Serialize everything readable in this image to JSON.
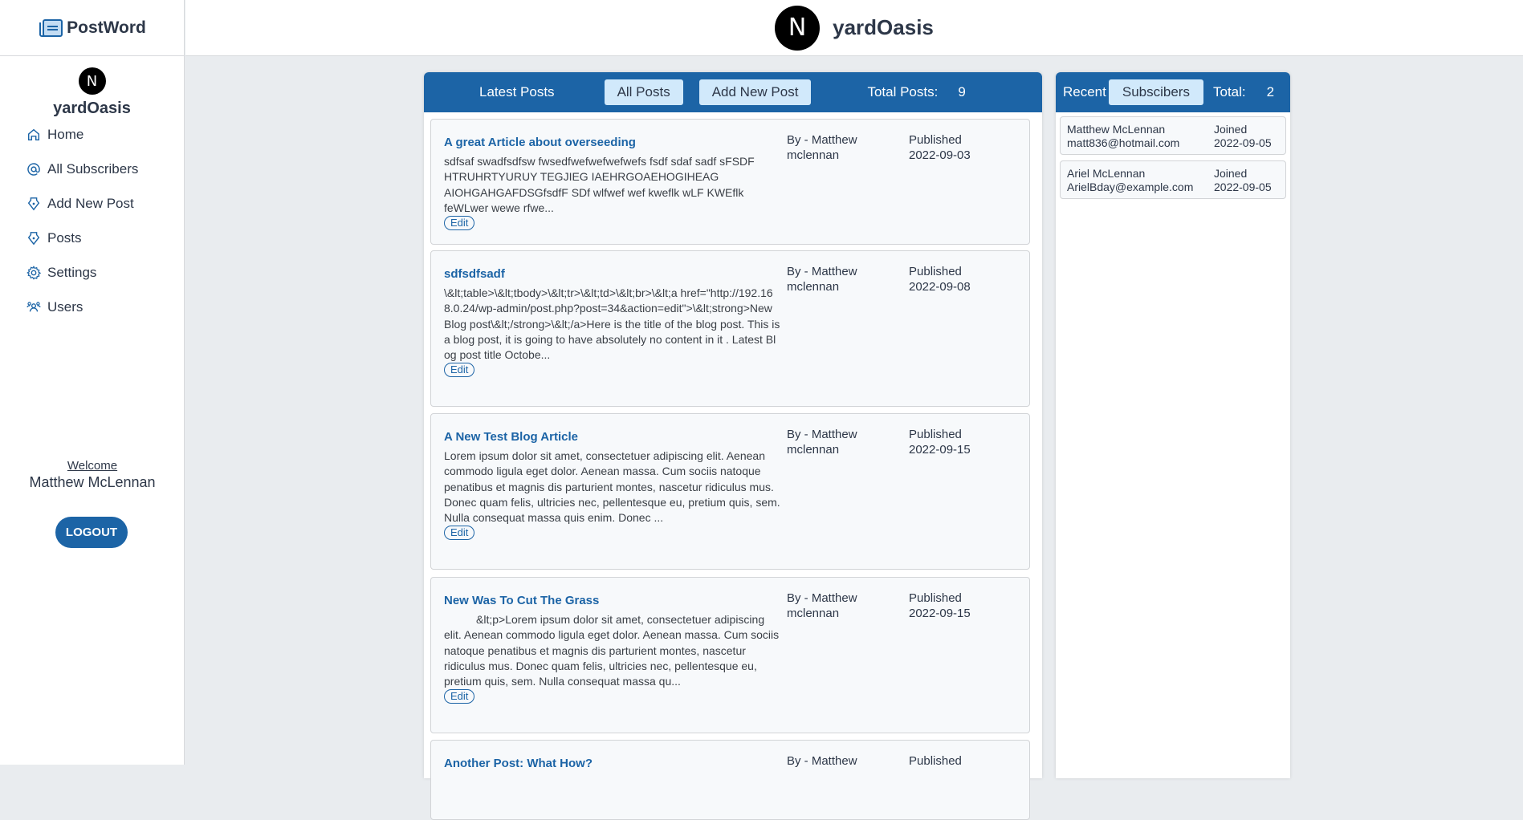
{
  "app": {
    "brand": "PostWord",
    "site_name": "yardOasis",
    "logo_letter": "N"
  },
  "sidebar": {
    "site_name": "yardOasis",
    "items": [
      {
        "label": "Home",
        "icon": "home-icon"
      },
      {
        "label": "All Subscribers",
        "icon": "at-icon"
      },
      {
        "label": "Add New Post",
        "icon": "pen-icon"
      },
      {
        "label": "Posts",
        "icon": "pen-icon"
      },
      {
        "label": "Settings",
        "icon": "gear-icon"
      },
      {
        "label": "Users",
        "icon": "users-icon"
      }
    ],
    "welcome_label": "Welcome",
    "user_name": "Matthew McLennan",
    "logout_label": "LOGOUT"
  },
  "posts_panel": {
    "heading": "Latest Posts",
    "all_posts_label": "All Posts",
    "add_new_label": "Add New Post",
    "total_label": "Total Posts:",
    "total_value": "9",
    "edit_label": "Edit",
    "posts": [
      {
        "title": "A great Article about overseeding",
        "excerpt": "sdfsaf swadfsdfsw fwsedfwefwefwefwefs fsdf sdaf sadf sFSDF HTRUHRTYURUY TEGJIEG IAEHRGOAEHOGIHEAG AIOHGAHGAFDSGfsdfF SDf wlfwef wef kweflk wLF KWEflk feWLwer wewe rfwe...",
        "author_line1": "By - Matthew",
        "author_line2": "mclennan",
        "published_label": "Published",
        "date": "2022-09-03"
      },
      {
        "title": "sdfsdfsadf",
        "excerpt": "\\&lt;table>\\&lt;tbody>\\&lt;tr>\\&lt;td>\\&lt;br>\\&lt;a href=\"http://192.168.0.24/wp-admin/post.php?post=34&action=edit\">\\&lt;strong>New Blog post\\&lt;/strong>\\&lt;/a>Here is the title of the blog post. This is a blog post, it is going to have absolutely no content in it . Latest Blog post title Octobe...",
        "author_line1": "By - Matthew",
        "author_line2": "mclennan",
        "published_label": "Published",
        "date": "2022-09-08"
      },
      {
        "title": "A New Test Blog Article",
        "excerpt": "Lorem ipsum dolor sit amet, consectetuer adipiscing elit. Aenean commodo ligula eget dolor. Aenean massa. Cum sociis natoque penatibus et magnis dis parturient montes, nascetur ridiculus mus. Donec quam felis, ultricies nec, pellentesque eu, pretium quis, sem. Nulla consequat massa quis enim. Donec ...",
        "author_line1": "By - Matthew",
        "author_line2": "mclennan",
        "published_label": "Published",
        "date": "2022-09-15"
      },
      {
        "title": "New Was To Cut The Grass",
        "excerpt": "&lt;p>Lorem ipsum dolor sit amet, consectetuer adipiscing elit. Aenean commodo ligula eget dolor. Aenean massa. Cum sociis natoque penatibus et magnis dis parturient montes, nascetur ridiculus mus. Donec quam felis, ultricies nec, pellentesque eu, pretium quis, sem. Nulla consequat massa qu...",
        "author_line1": "By - Matthew",
        "author_line2": "mclennan",
        "published_label": "Published",
        "date": "2022-09-15"
      },
      {
        "title": "Another Post: What How?",
        "author_line1": "By - Matthew",
        "published_label": "Published"
      }
    ]
  },
  "subs_panel": {
    "recent_label": "Recent",
    "subscribers_label": "Subscibers",
    "total_label": "Total:",
    "total_value": "2",
    "joined_label": "Joined",
    "subscribers": [
      {
        "name": "Matthew McLennan",
        "email": "matt836@hotmail.com",
        "date": "2022-09-05"
      },
      {
        "name": "Ariel McLennan",
        "email": "ArielBday@example.com",
        "date": "2022-09-05"
      }
    ]
  }
}
